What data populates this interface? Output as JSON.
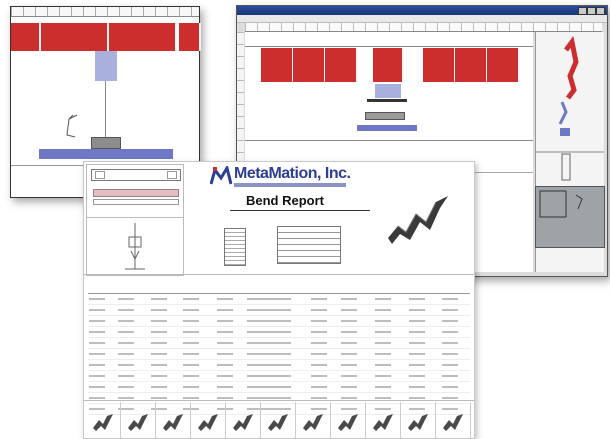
{
  "report": {
    "company": "MetaMation, Inc.",
    "title": "Bend Report",
    "table": {
      "headers": [
        "",
        "",
        "",
        "",
        "",
        "",
        "",
        "",
        "",
        "",
        ""
      ],
      "rows": [
        [
          "",
          "",
          "",
          "",
          "",
          "",
          "",
          "",
          "",
          "",
          ""
        ],
        [
          "",
          "",
          "",
          "",
          "",
          "",
          "",
          "",
          "",
          "",
          ""
        ],
        [
          "",
          "",
          "",
          "",
          "",
          "",
          "",
          "",
          "",
          "",
          ""
        ],
        [
          "",
          "",
          "",
          "",
          "",
          "",
          "",
          "",
          "",
          "",
          ""
        ],
        [
          "",
          "",
          "",
          "",
          "",
          "",
          "",
          "",
          "",
          "",
          ""
        ],
        [
          "",
          "",
          "",
          "",
          "",
          "",
          "",
          "",
          "",
          "",
          ""
        ],
        [
          "",
          "",
          "",
          "",
          "",
          "",
          "",
          "",
          "",
          "",
          ""
        ],
        [
          "",
          "",
          "",
          "",
          "",
          "",
          "",
          "",
          "",
          "",
          ""
        ],
        [
          "",
          "",
          "",
          "",
          "",
          "",
          "",
          "",
          "",
          "",
          ""
        ],
        [
          "",
          "",
          "",
          "",
          "",
          "",
          "",
          "",
          "",
          "",
          ""
        ],
        [
          "",
          "",
          "",
          "",
          "",
          "",
          "",
          "",
          "",
          "",
          ""
        ]
      ]
    },
    "thumbnail_count": 11
  },
  "colors": {
    "tool_red": "#cc2e2e",
    "die_blue": "#6f78c4",
    "punch_lavender": "#a9b0dd",
    "brand_blue": "#2c3f92",
    "titlebar_blue": "#2b4fa0"
  }
}
